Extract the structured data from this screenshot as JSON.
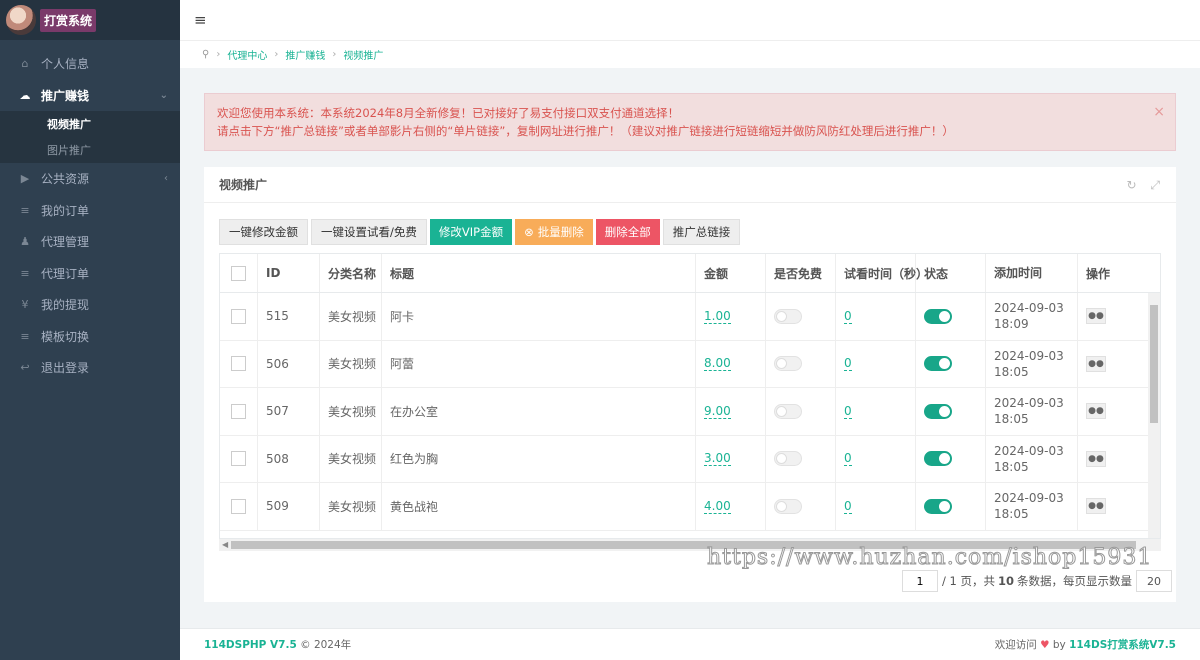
{
  "brand": {
    "logo_text": "打赏系统"
  },
  "sidebar": {
    "items": [
      {
        "label": "个人信息",
        "icon": "home-icon"
      },
      {
        "label": "推广赚钱",
        "icon": "cloud-icon"
      },
      {
        "label": "公共资源",
        "icon": "video-icon"
      },
      {
        "label": "我的订单",
        "icon": "list-icon"
      },
      {
        "label": "代理管理",
        "icon": "users-icon"
      },
      {
        "label": "代理订单",
        "icon": "list-icon"
      },
      {
        "label": "我的提现",
        "icon": "yen-icon"
      },
      {
        "label": "模板切换",
        "icon": "list-icon"
      },
      {
        "label": "退出登录",
        "icon": "logout-icon"
      }
    ],
    "submenu": [
      "视频推广",
      "图片推广"
    ]
  },
  "breadcrumb": [
    "代理中心",
    "推广赚钱",
    "视频推广"
  ],
  "alert": {
    "line1": "欢迎您使用本系统：本系统2024年8月全新修复！已对接好了易支付接口双支付通道选择！",
    "line2": "请点击下方“推广总链接”或者单部影片右侧的“单片链接”，复制网址进行推广！（建议对推广链接进行短链缩短并做防风防红处理后进行推广！）"
  },
  "panel": {
    "title": "视频推广"
  },
  "toolbar": {
    "edit_amount": "一键修改金额",
    "set_trial": "一键设置试看/免费",
    "edit_vip": "修改VIP金额",
    "batch_delete": "批量删除",
    "delete_all": "删除全部",
    "master_link": "推广总链接"
  },
  "table": {
    "headers": [
      "ID",
      "分类名称",
      "标题",
      "金额",
      "是否免费",
      "试看时间（秒）",
      "状态",
      "添加时间",
      "操作"
    ],
    "rows": [
      {
        "id": "515",
        "cat": "美女视频",
        "title": "阿卡",
        "amount": "1.00",
        "trial": "0",
        "time": "2024-09-03 18:09"
      },
      {
        "id": "506",
        "cat": "美女视频",
        "title": "阿蕾",
        "amount": "8.00",
        "trial": "0",
        "time": "2024-09-03 18:05"
      },
      {
        "id": "507",
        "cat": "美女视频",
        "title": "在办公室",
        "amount": "9.00",
        "trial": "0",
        "time": "2024-09-03 18:05"
      },
      {
        "id": "508",
        "cat": "美女视频",
        "title": "红色为胸",
        "amount": "3.00",
        "trial": "0",
        "time": "2024-09-03 18:05"
      },
      {
        "id": "509",
        "cat": "美女视频",
        "title": "黄色战袍",
        "amount": "4.00",
        "trial": "0",
        "time": "2024-09-03 18:05"
      }
    ]
  },
  "pager": {
    "page": "1",
    "of_pages": "/ 1 页，共",
    "total": "10",
    "unit_text": "条数据，每页显示数量",
    "per_page": "20"
  },
  "watermark": "https://www.huzhan.com/ishop15931",
  "footer": {
    "left_brand": "114DSPHP V7.5",
    "left_copy": "© 2024年",
    "right_text": "欢迎访问",
    "right_by": "by",
    "right_brand": "114DS打赏系统V7.5"
  }
}
